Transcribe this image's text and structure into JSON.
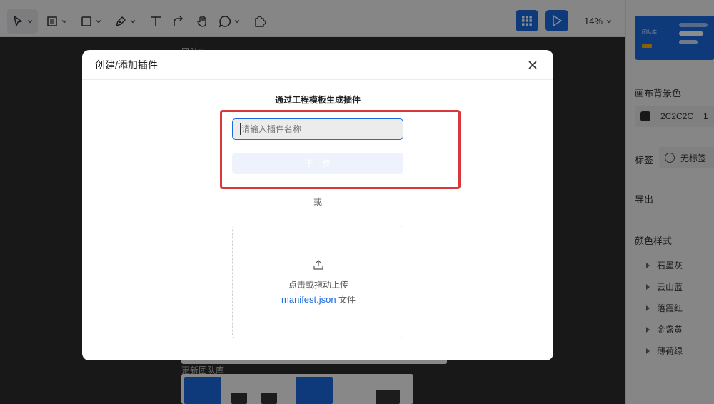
{
  "toolbar": {
    "tools": [
      "select-tool",
      "frame-tool",
      "shape-tool",
      "pen-tool",
      "text-tool",
      "connector-tool",
      "hand-tool",
      "comment-tool",
      "plugin-tool"
    ],
    "zoom": "14%"
  },
  "right_panel": {
    "thumbnail_title": "团队库",
    "canvas_bg_label": "画布背景色",
    "canvas_bg_value": "2C2C2C",
    "canvas_bg_opacity": "1",
    "tag_label": "标签",
    "tag_value": "无标签",
    "export_label": "导出",
    "color_style_label": "颜色样式",
    "color_styles": [
      "石墨灰",
      "云山蓝",
      "落霞红",
      "金盏黄",
      "薄荷绿"
    ]
  },
  "canvas": {
    "top_label": "团队库",
    "bottom_label": "更新团队库"
  },
  "modal": {
    "title": "创建/添加插件",
    "subtitle": "通过工程模板生成插件",
    "input_placeholder": "请输入插件名称",
    "next_button": "下一步",
    "or_text": "或",
    "upload_text": "点击或拖动上传",
    "upload_file_name": "manifest.json",
    "upload_file_suffix": "文件"
  },
  "colors": {
    "accent": "#1b6ae0",
    "highlight": "#d9383a",
    "canvas": "#2c2c2c"
  }
}
